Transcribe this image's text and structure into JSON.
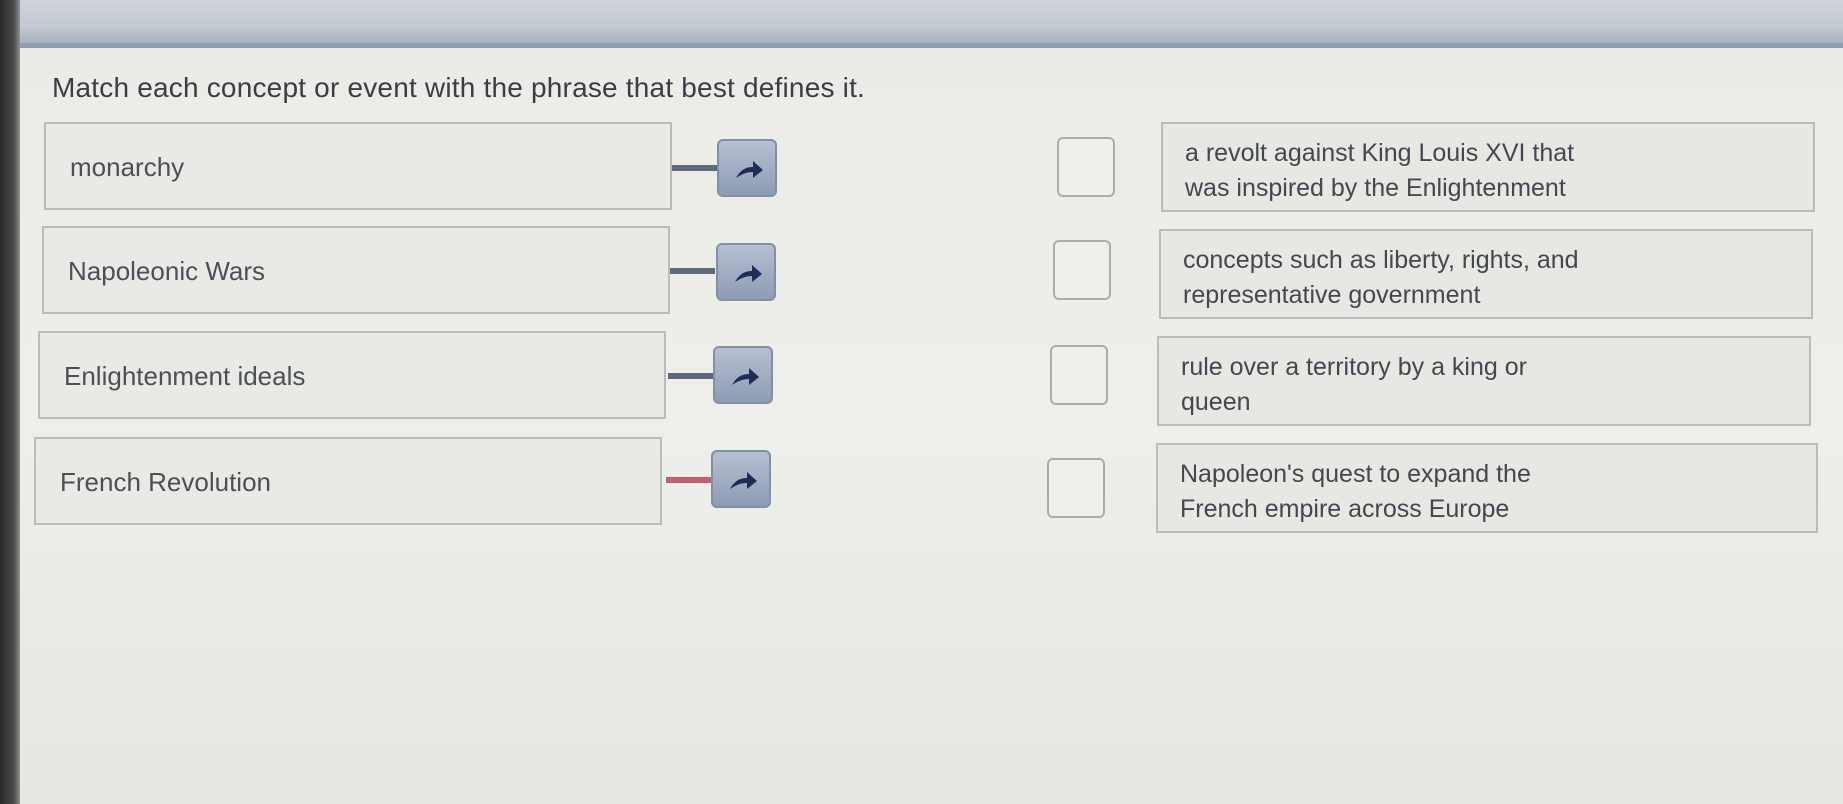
{
  "instructions": "Match each concept or event with the phrase that best defines it.",
  "concepts": [
    {
      "label": "monarchy"
    },
    {
      "label": "Napoleonic Wars"
    },
    {
      "label": "Enlightenment ideals"
    },
    {
      "label": "French Revolution"
    }
  ],
  "definitions": [
    {
      "line1": "a revolt against King Louis XVI that",
      "line2": "was inspired by the Enlightenment"
    },
    {
      "line1": "concepts such as liberty, rights, and",
      "line2": "representative government"
    },
    {
      "line1": "rule over a territory by a king or",
      "line2": "queen"
    },
    {
      "line1": "Napoleon's quest to expand the",
      "line2": "French empire across Europe"
    }
  ],
  "icons": {
    "drag_handle": "arrow-right-icon",
    "drop_target": "empty-checkbox"
  },
  "colors": {
    "connector": "#5f6a7b",
    "connector_active": "#c0606f",
    "arrow_button": "#9aa6bd"
  }
}
